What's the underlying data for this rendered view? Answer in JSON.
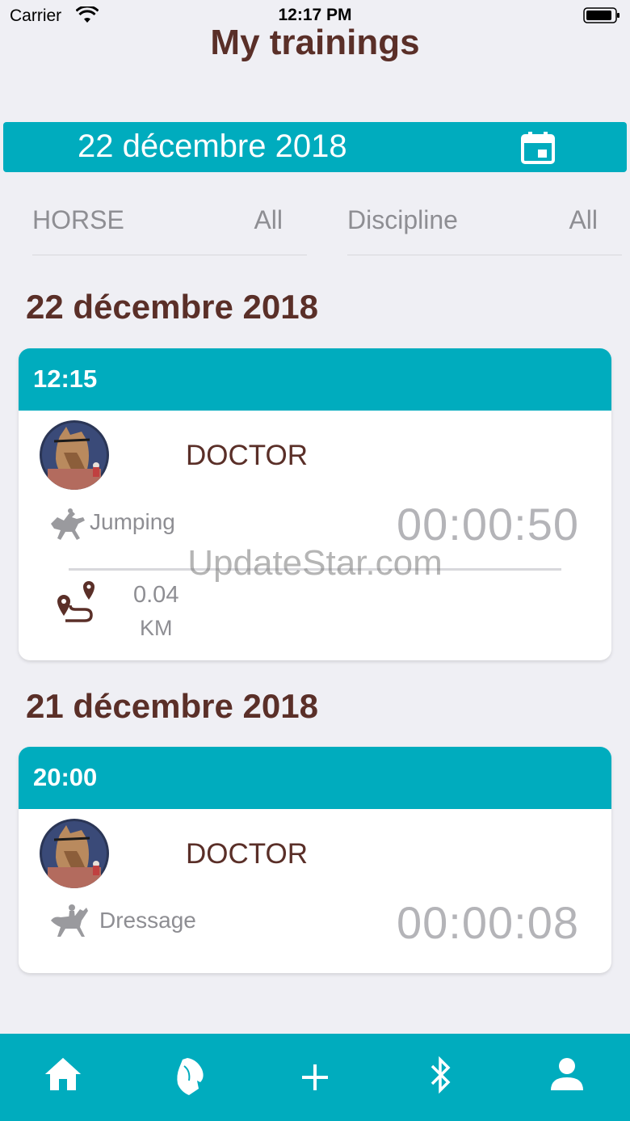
{
  "status_bar": {
    "carrier": "Carrier",
    "time": "12:17 PM"
  },
  "page": {
    "title": "My trainings"
  },
  "date_picker": {
    "value": "22 décembre 2018",
    "icon": "calendar-icon"
  },
  "filters": {
    "horse": {
      "label": "HORSE",
      "value": "All"
    },
    "discipline": {
      "label": "Discipline",
      "value": "All"
    }
  },
  "sections": [
    {
      "date": "22 décembre 2018",
      "trainings": [
        {
          "time": "12:15",
          "horse": "DOCTOR",
          "discipline": "Jumping",
          "discipline_icon": "jumping-horse-icon",
          "duration": "00:00:50",
          "distance_value": "0.04",
          "distance_unit": "KM"
        }
      ]
    },
    {
      "date": "21 décembre 2018",
      "trainings": [
        {
          "time": "20:00",
          "horse": "DOCTOR",
          "discipline": "Dressage",
          "discipline_icon": "dressage-horse-icon",
          "duration": "00:00:08"
        }
      ]
    }
  ],
  "watermark": "UpdateStar.com",
  "tab_bar": {
    "items": [
      "home-icon",
      "horse-head-icon",
      "plus-icon",
      "bluetooth-icon",
      "profile-icon"
    ]
  },
  "colors": {
    "accent": "#00acbe",
    "heading": "#5a2f28",
    "muted": "#8e8e93",
    "background": "#efeff4"
  }
}
